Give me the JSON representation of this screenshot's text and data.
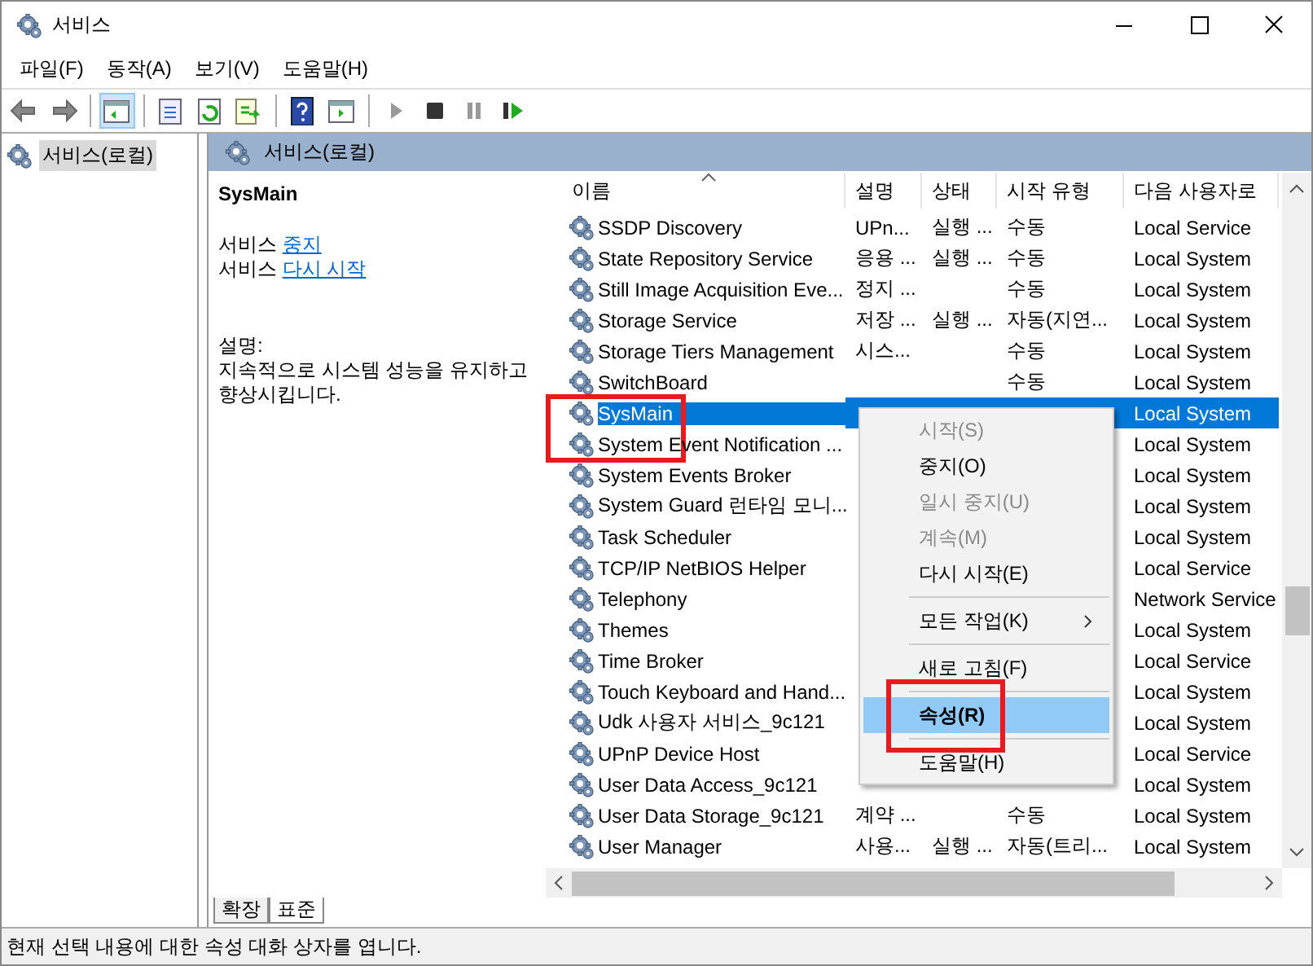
{
  "window": {
    "title": "서비스"
  },
  "menu_bar": [
    "파일(F)",
    "동작(A)",
    "보기(V)",
    "도움말(H)"
  ],
  "toolbar": [
    {
      "kind": "back"
    },
    {
      "kind": "forward"
    },
    {
      "kind": "sep"
    },
    {
      "kind": "pane",
      "selected": true
    },
    {
      "kind": "sep"
    },
    {
      "kind": "list"
    },
    {
      "kind": "refresh"
    },
    {
      "kind": "export"
    },
    {
      "kind": "sep"
    },
    {
      "kind": "help"
    },
    {
      "kind": "console"
    },
    {
      "kind": "sep"
    },
    {
      "kind": "play",
      "disabled": true
    },
    {
      "kind": "stop",
      "disabled": false
    },
    {
      "kind": "pause",
      "disabled": true
    },
    {
      "kind": "resume",
      "disabled": false
    }
  ],
  "tree": [
    {
      "label": "서비스(로컬)",
      "selected": true
    }
  ],
  "panel_header": "서비스(로컬)",
  "detail": {
    "name": "SysMain",
    "actions": [
      {
        "prefix": "서비스",
        "link": "중지"
      },
      {
        "prefix": "서비스",
        "link": "다시 시작"
      }
    ],
    "description_label": "설명:",
    "description": "지속적으로 시스템 성능을 유지하고 향상시킵니다."
  },
  "table": {
    "columns": [
      "이름",
      "설명",
      "상태",
      "시작 유형",
      "다음 사용자로"
    ],
    "rows": [
      {
        "name": "SSDP Discovery",
        "description": "UPn...",
        "status": "실행 ...",
        "startup": "수동",
        "logon": "Local Service",
        "selected": false
      },
      {
        "name": "State Repository Service",
        "description": "응용 ...",
        "status": "실행 ...",
        "startup": "수동",
        "logon": "Local System",
        "selected": false
      },
      {
        "name": "Still Image Acquisition Eve...",
        "description": "정지 ...",
        "status": "",
        "startup": "수동",
        "logon": "Local System",
        "selected": false
      },
      {
        "name": "Storage Service",
        "description": "저장 ...",
        "status": "실행 ...",
        "startup": "자동(지연...",
        "logon": "Local System",
        "selected": false
      },
      {
        "name": "Storage Tiers Management",
        "description": "시스...",
        "status": "",
        "startup": "수동",
        "logon": "Local System",
        "selected": false
      },
      {
        "name": "SwitchBoard",
        "description": "",
        "status": "",
        "startup": "수동",
        "logon": "Local System",
        "selected": false
      },
      {
        "name": "SysMain",
        "description": "",
        "status": "",
        "startup": "",
        "logon": "Local System",
        "selected": true,
        "annotated": true
      },
      {
        "name": "System Event Notification ...",
        "description": "",
        "status": "",
        "startup": "",
        "logon": "Local System",
        "selected": false
      },
      {
        "name": "System Events Broker",
        "description": "",
        "status": "",
        "startup": "",
        "logon": "Local System",
        "selected": false
      },
      {
        "name": "System Guard 런타임 모니...",
        "description": "",
        "status": "",
        "startup": "",
        "logon": "Local System",
        "selected": false
      },
      {
        "name": "Task Scheduler",
        "description": "",
        "status": "",
        "startup": "",
        "logon": "Local System",
        "selected": false
      },
      {
        "name": "TCP/IP NetBIOS Helper",
        "description": "",
        "status": "",
        "startup": "",
        "logon": "Local Service",
        "selected": false
      },
      {
        "name": "Telephony",
        "description": "",
        "status": "",
        "startup": "",
        "logon": "Network Service",
        "selected": false
      },
      {
        "name": "Themes",
        "description": "",
        "status": "",
        "startup": "",
        "logon": "Local System",
        "selected": false
      },
      {
        "name": "Time Broker",
        "description": "",
        "status": "",
        "startup": "",
        "logon": "Local Service",
        "selected": false
      },
      {
        "name": "Touch Keyboard and Hand...",
        "description": "",
        "status": "",
        "startup": "",
        "logon": "Local System",
        "selected": false
      },
      {
        "name": "Udk 사용자 서비스_9c121",
        "description": "",
        "status": "",
        "startup": "",
        "logon": "Local System",
        "selected": false
      },
      {
        "name": "UPnP Device Host",
        "description": "",
        "status": "",
        "startup": "",
        "logon": "Local Service",
        "selected": false
      },
      {
        "name": "User Data Access_9c121",
        "description": "",
        "status": "",
        "startup": "",
        "logon": "Local System",
        "selected": false
      },
      {
        "name": "User Data Storage_9c121",
        "description": "계약 ...",
        "status": "",
        "startup": "수동",
        "logon": "Local System",
        "selected": false
      },
      {
        "name": "User Manager",
        "description": "사용...",
        "status": "실행 ...",
        "startup": "자동(트리...",
        "logon": "Local System",
        "selected": false
      }
    ]
  },
  "context_menu": [
    {
      "kind": "item",
      "label": "시작(S)",
      "disabled": true,
      "selected": false
    },
    {
      "kind": "item",
      "label": "중지(O)",
      "disabled": false,
      "selected": false
    },
    {
      "kind": "item",
      "label": "일시 중지(U)",
      "disabled": true,
      "selected": false
    },
    {
      "kind": "item",
      "label": "계속(M)",
      "disabled": true,
      "selected": false
    },
    {
      "kind": "item",
      "label": "다시 시작(E)",
      "disabled": false,
      "selected": false
    },
    {
      "kind": "separator"
    },
    {
      "kind": "submenu",
      "label": "모든 작업(K)",
      "disabled": false,
      "selected": false
    },
    {
      "kind": "separator"
    },
    {
      "kind": "item",
      "label": "새로 고침(F)",
      "disabled": false,
      "selected": false
    },
    {
      "kind": "separator"
    },
    {
      "kind": "item",
      "label": "속성(R)",
      "disabled": false,
      "selected": true,
      "annotated": true
    },
    {
      "kind": "separator"
    },
    {
      "kind": "item",
      "label": "도움말(H)",
      "disabled": false,
      "selected": false
    }
  ],
  "view_tabs": [
    {
      "label": "확장",
      "selected": false
    },
    {
      "label": "표준",
      "selected": true
    }
  ],
  "status_bar": "현재 선택 내용에 대한 속성 대화 상자를 엽니다."
}
